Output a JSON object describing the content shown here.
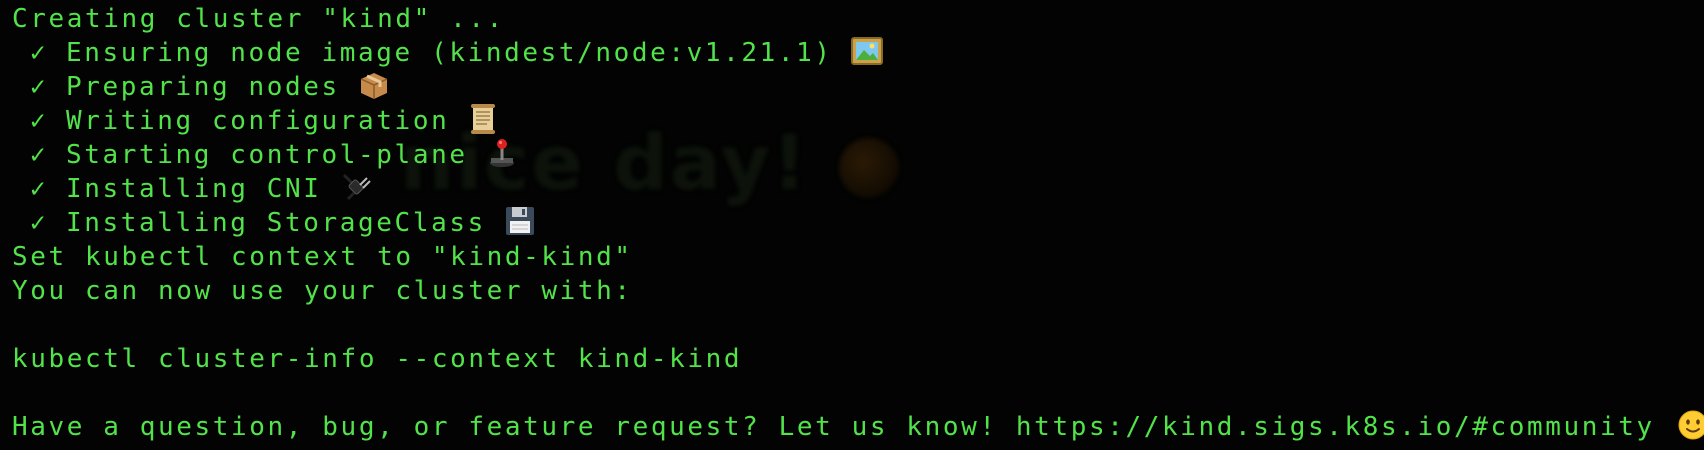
{
  "terminal": {
    "colors": {
      "background": "#020302",
      "text": "#52e34a"
    },
    "background_text": "nice day!",
    "lines": [
      {
        "text": "Creating cluster \"kind\" ..."
      },
      {
        "check": "✓",
        "text": "Ensuring node image (kindest/node:v1.21.1)",
        "icon": "framed-picture-icon"
      },
      {
        "check": "✓",
        "text": "Preparing nodes",
        "icon": "package-icon"
      },
      {
        "check": "✓",
        "text": "Writing configuration",
        "icon": "scroll-icon"
      },
      {
        "check": "✓",
        "text": "Starting control-plane",
        "icon": "joystick-icon"
      },
      {
        "check": "✓",
        "text": "Installing CNI",
        "icon": "electric-plug-icon"
      },
      {
        "check": "✓",
        "text": "Installing StorageClass",
        "icon": "floppy-disk-icon"
      },
      {
        "text": "Set kubectl context to \"kind-kind\""
      },
      {
        "text": "You can now use your cluster with:"
      },
      {
        "text": ""
      },
      {
        "text": "kubectl cluster-info --context kind-kind"
      },
      {
        "text": ""
      },
      {
        "text": "Have a question, bug, or feature request? Let us know! https://kind.sigs.k8s.io/#community",
        "icon": "slightly-smiling-face-icon"
      }
    ]
  }
}
